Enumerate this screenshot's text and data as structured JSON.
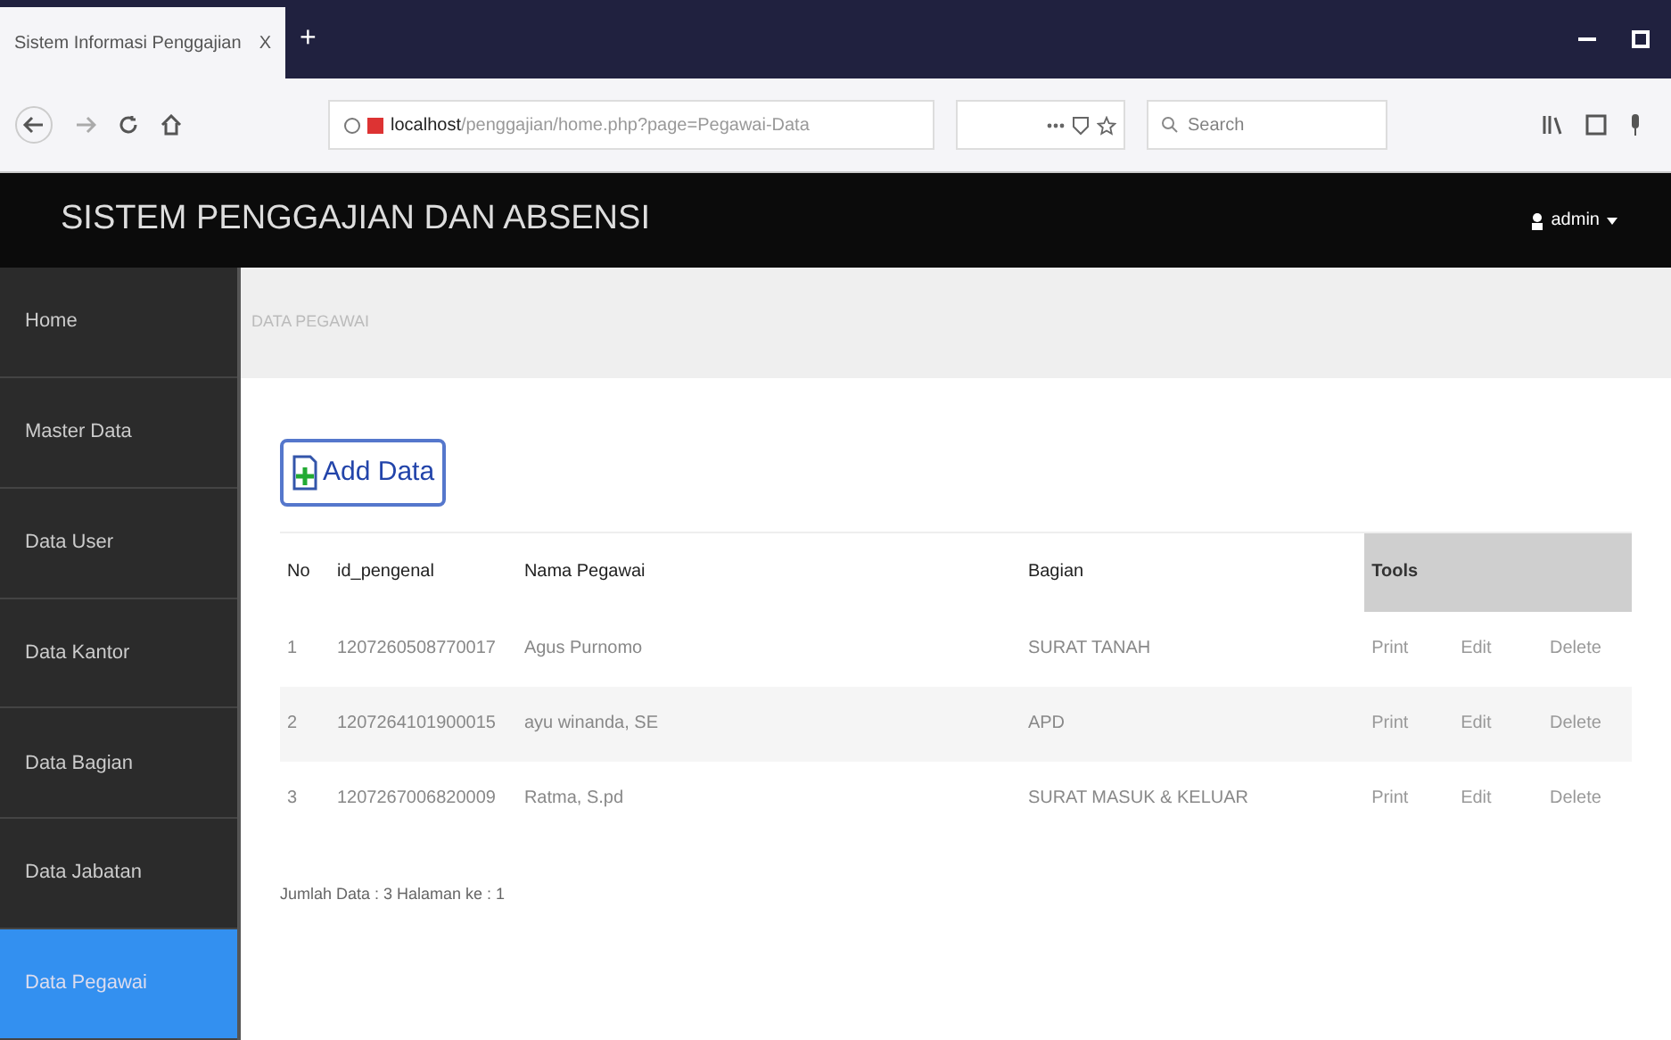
{
  "browser": {
    "tab_title": "Sistem Informasi Penggajian",
    "tab_close": "X",
    "new_tab": "+",
    "url_host": "localhost",
    "url_path": "/penggajian/home.php?page=Pegawai-Data",
    "search_placeholder": "Search"
  },
  "header": {
    "title": "SISTEM PENGGAJIAN DAN ABSENSI",
    "user": "admin"
  },
  "sidebar": {
    "items": [
      {
        "label": "Home",
        "selected": false
      },
      {
        "label": "Master Data",
        "selected": false
      },
      {
        "label": "Data User",
        "selected": false
      },
      {
        "label": "Data Kantor",
        "selected": false
      },
      {
        "label": "Data Bagian",
        "selected": false
      },
      {
        "label": "Data Jabatan",
        "selected": false
      },
      {
        "label": "Data Pegawai",
        "selected": true
      }
    ]
  },
  "breadcrumb": "DATA PEGAWAI",
  "add_button": "Add Data",
  "table": {
    "columns": [
      "No",
      "id_pengenal",
      "Nama Pegawai",
      "Bagian",
      "Tools"
    ],
    "rows": [
      {
        "no": "1",
        "id": "1207260508770017",
        "nama": "Agus Purnomo",
        "bagian": "SURAT TANAH",
        "actions": [
          "Print",
          "Edit",
          "Delete"
        ]
      },
      {
        "no": "2",
        "id": "1207264101900015",
        "nama": "ayu winanda, SE",
        "bagian": "APD",
        "actions": [
          "Print",
          "Edit",
          "Delete"
        ]
      },
      {
        "no": "3",
        "id": "1207267006820009",
        "nama": "Ratma, S.pd",
        "bagian": "SURAT MASUK & KELUAR",
        "actions": [
          "Print",
          "Edit",
          "Delete"
        ]
      }
    ]
  },
  "footer": "Jumlah Data : 3 Halaman ke : 1"
}
